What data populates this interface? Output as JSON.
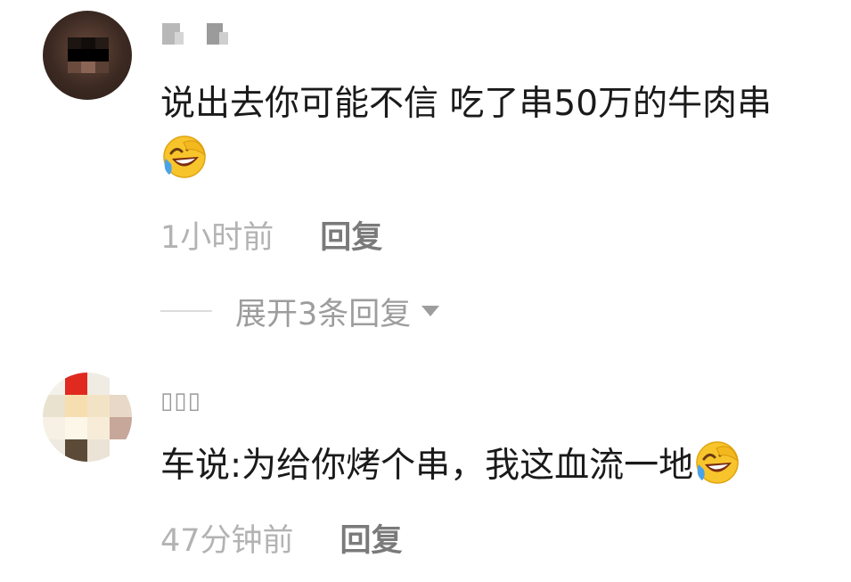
{
  "comments": [
    {
      "body": "说出去你可能不信 吃了串50万的牛肉串",
      "emoji": "laughing-crying-emoji-icon",
      "time": "1小时前",
      "reply_label": "回复",
      "expand_label": "展开3条回复"
    },
    {
      "username": "▯▯▯",
      "body": "车说:为给你烤个串，我这血流一地",
      "emoji": "laughing-crying-emoji-icon",
      "time": "47分钟前",
      "reply_label": "回复"
    }
  ],
  "colors": {
    "text": "#1a1a1a",
    "time": "#b3b3b3",
    "reply": "#7a7a7a",
    "expand": "#9d9d9d",
    "emoji_face": "#f7c52b"
  }
}
